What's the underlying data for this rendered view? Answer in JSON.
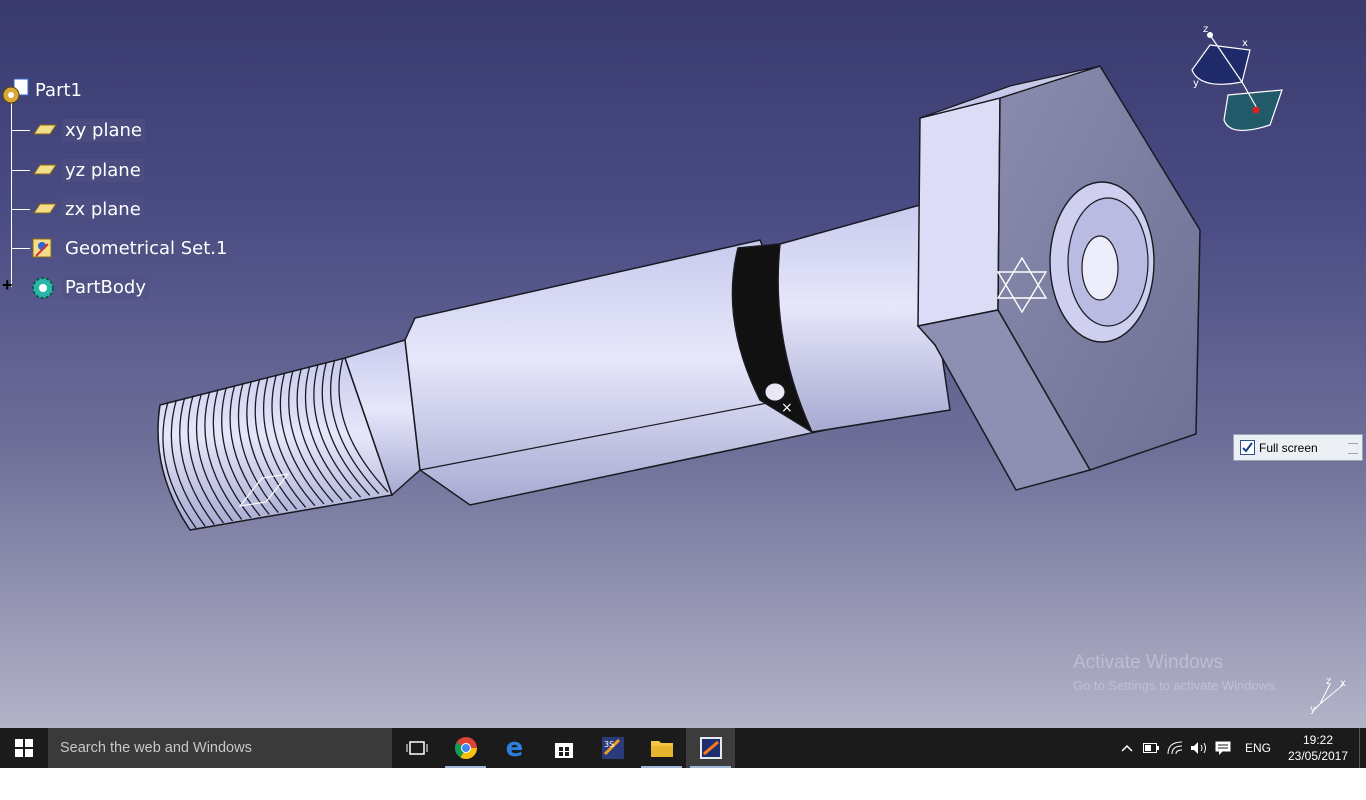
{
  "spec_tree": {
    "root": {
      "label": "Part1",
      "icon": "part-gear-icon"
    },
    "items": [
      {
        "label": "xy plane",
        "icon": "plane-icon"
      },
      {
        "label": "yz plane",
        "icon": "plane-icon"
      },
      {
        "label": "zx plane",
        "icon": "plane-icon"
      },
      {
        "label": "Geometrical Set.1",
        "icon": "geometrical-set-icon"
      },
      {
        "label": "PartBody",
        "icon": "partbody-gear-icon",
        "expander": "+"
      }
    ]
  },
  "compass": {
    "axis_z": "z",
    "axis_x": "x",
    "axis_y": "y"
  },
  "fullscreen_toolbar": {
    "label": "Full screen",
    "checked": true
  },
  "watermark": {
    "title": "Activate Windows",
    "subtitle": "Go to Settings to activate Windows."
  },
  "mini_axis": {
    "x": "x",
    "y": "y",
    "z": "z"
  },
  "taskbar": {
    "search_placeholder": "Search the web and Windows",
    "apps": [
      "task-view-icon",
      "chrome-icon",
      "edge-icon",
      "store-icon",
      "catia-launcher-icon",
      "file-explorer-icon",
      "catia-app-icon"
    ],
    "language": "ENG",
    "time": "19:22",
    "date": "23/05/2017"
  },
  "colors": {
    "part_face": "#d6d7f2",
    "part_edge": "#1a1a22",
    "tree_text": "#ffffff",
    "taskbar": "#1b1b1b"
  }
}
